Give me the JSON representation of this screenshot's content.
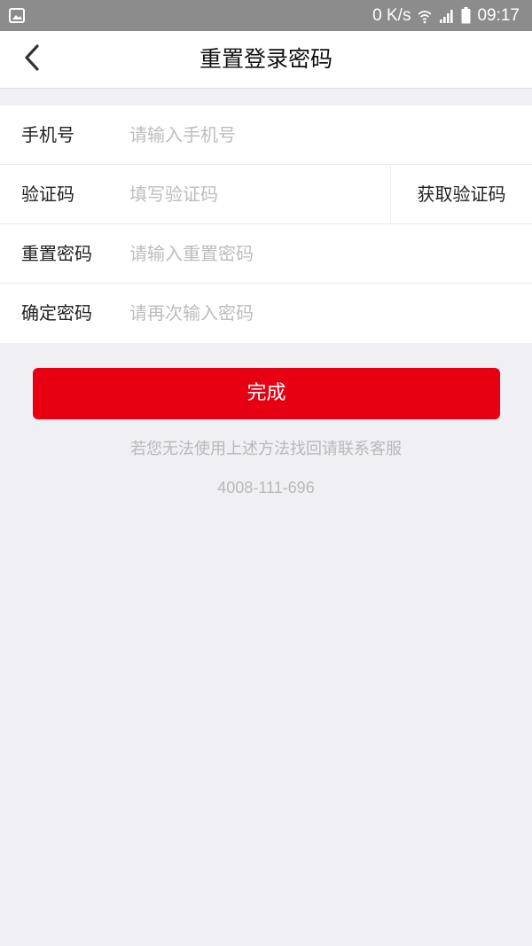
{
  "status_bar": {
    "network_speed": "0 K/s",
    "time": "09:17",
    "left_icon": "image-icon",
    "icons": [
      "wifi-icon",
      "signal-icon",
      "battery-icon"
    ]
  },
  "header": {
    "title": "重置登录密码",
    "back_icon": "chevron-left-icon"
  },
  "form": {
    "phone": {
      "label": "手机号",
      "placeholder": "请输入手机号",
      "value": ""
    },
    "code": {
      "label": "验证码",
      "placeholder": "填写验证码",
      "value": "",
      "button_label": "获取验证码"
    },
    "new_password": {
      "label": "重置密码",
      "placeholder": "请输入重置密码",
      "value": ""
    },
    "confirm_password": {
      "label": "确定密码",
      "placeholder": "请再次输入密码",
      "value": ""
    }
  },
  "actions": {
    "submit_label": "完成"
  },
  "help": {
    "text": "若您无法使用上述方法找回请联系客服",
    "phone": "4008-111-696"
  },
  "colors": {
    "accent": "#e60012",
    "background": "#efeff4",
    "status_bar": "#8c8c8c",
    "placeholder": "#bdbdbd"
  }
}
